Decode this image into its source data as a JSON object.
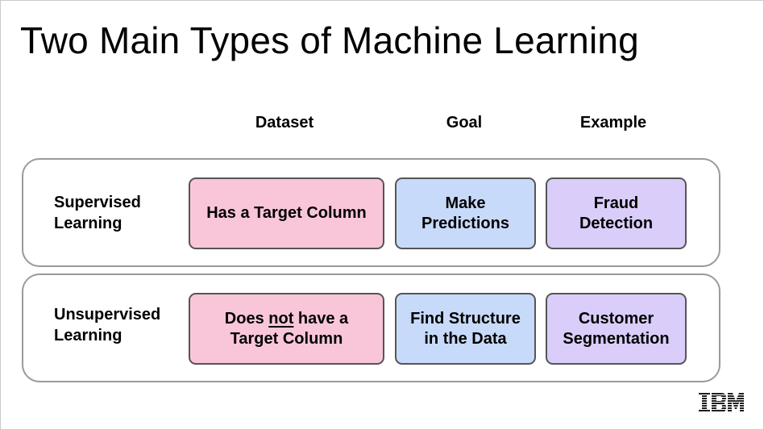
{
  "title": "Two Main Types of Machine Learning",
  "columns": [
    "Dataset",
    "Goal",
    "Example"
  ],
  "rows": [
    {
      "label": "Supervised\nLearning",
      "dataset": {
        "text": "Has a Target Column"
      },
      "goal": {
        "line1": "Make",
        "line2": "Predictions"
      },
      "example": {
        "line1": "Fraud",
        "line2": "Detection"
      }
    },
    {
      "label": "Unsupervised\nLearning",
      "dataset": {
        "pre": "Does ",
        "emph": "not",
        "post": " have a",
        "line2": "Target Column"
      },
      "goal": {
        "line1": "Find Structure",
        "line2": "in the Data"
      },
      "example": {
        "line1": "Customer",
        "line2": "Segmentation"
      }
    }
  ],
  "logo": {
    "text": "IBM",
    "icon": "ibm-logo"
  },
  "colors": {
    "dataset": "#f9c6d9",
    "goal": "#c8daf9",
    "example": "#dacdfa",
    "row_border": "#9a9a9a"
  }
}
